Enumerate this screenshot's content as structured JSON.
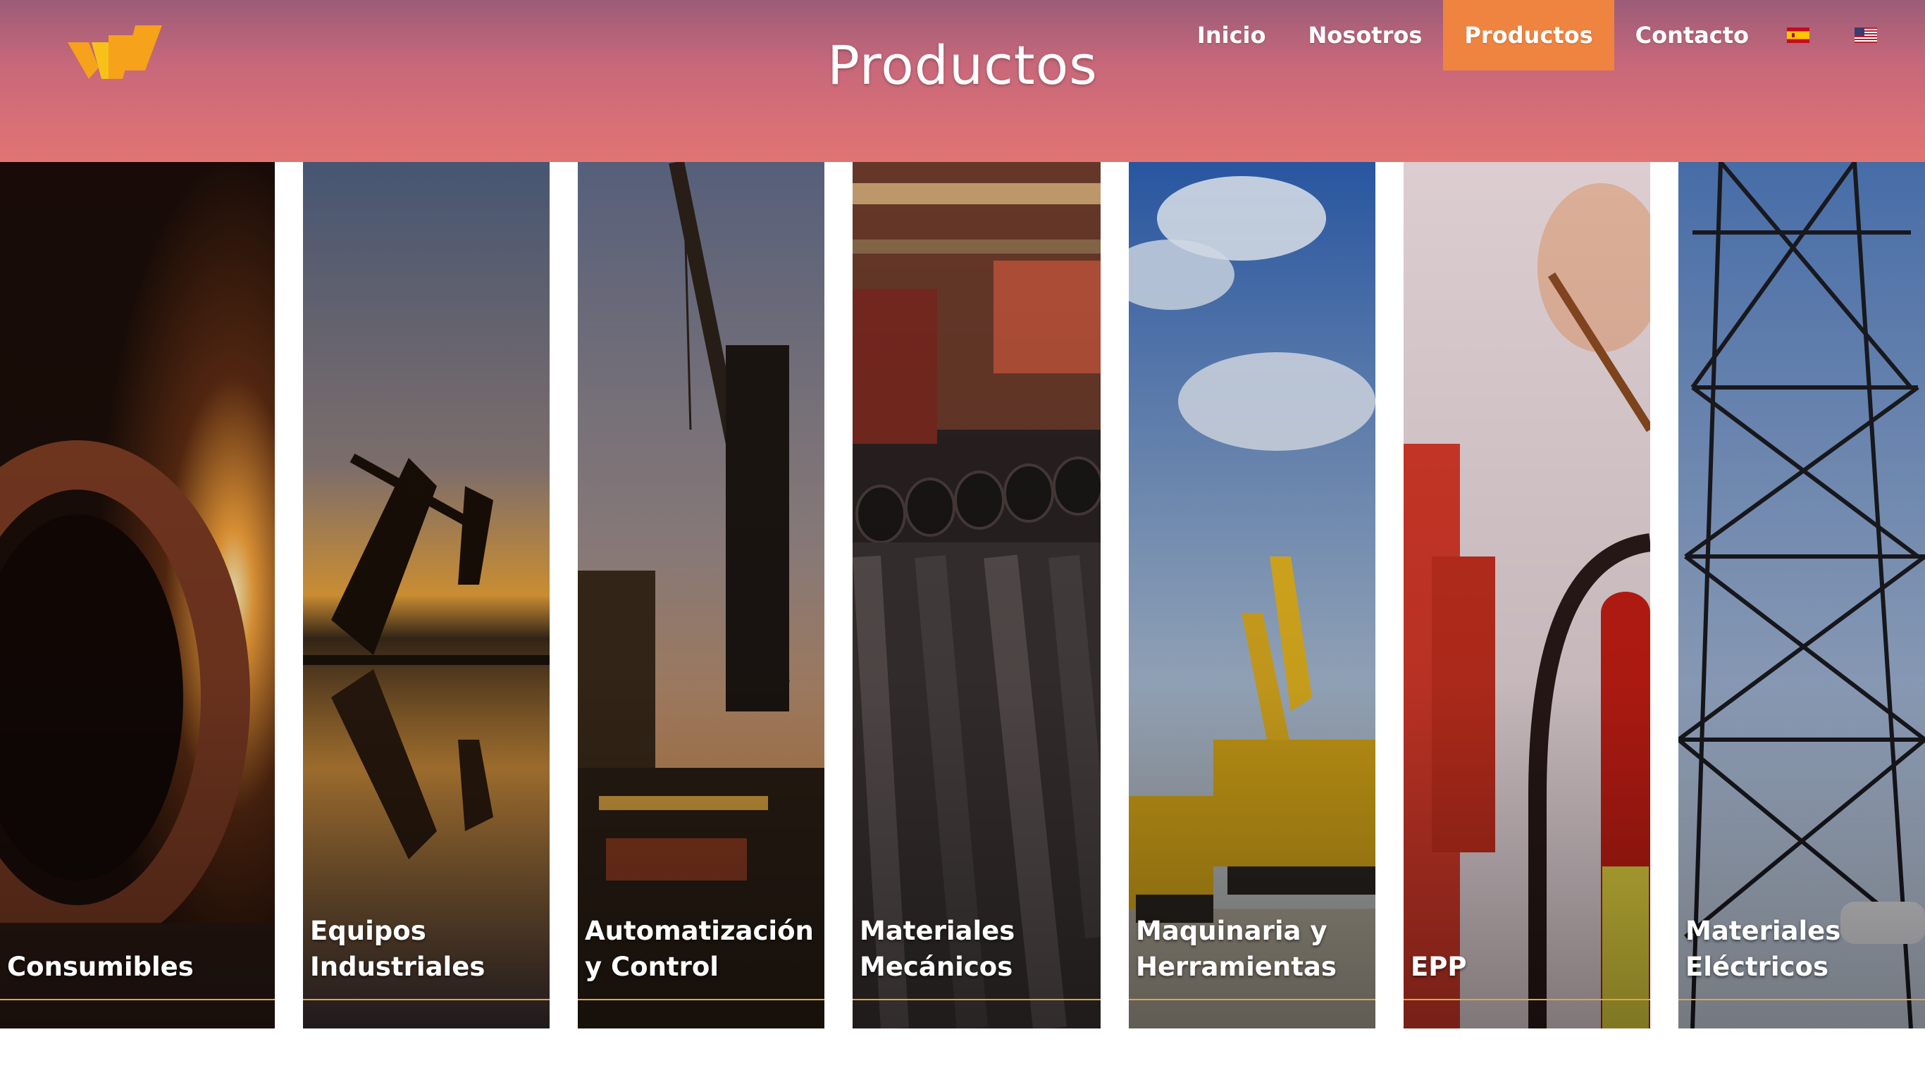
{
  "header": {
    "title": "Productos",
    "logo_name": "brand-logo",
    "colors": {
      "gradient_top": "#9c5c78",
      "gradient_bottom": "#e17473",
      "active_tab": "#ef8440",
      "logo": "#f6a21a"
    }
  },
  "nav": {
    "items": [
      {
        "label": "Inicio",
        "active": false
      },
      {
        "label": "Nosotros",
        "active": false
      },
      {
        "label": "Productos",
        "active": true
      },
      {
        "label": "Contacto",
        "active": false
      }
    ],
    "languages": [
      {
        "icon": "spain-flag-icon"
      },
      {
        "icon": "usa-flag-icon"
      }
    ]
  },
  "categories": [
    {
      "label": "Consumibles",
      "image": "welding-pipe-sparks"
    },
    {
      "label": "Equipos Industriales",
      "image": "oil-pumpjack-sunset"
    },
    {
      "label": "Automatización y Control",
      "image": "offshore-rig-crane"
    },
    {
      "label": "Materiales Mecánicos",
      "image": "steel-pipes-warehouse"
    },
    {
      "label": "Maquinaria y Herramientas",
      "image": "yellow-excavators"
    },
    {
      "label": "EPP",
      "image": "fire-extinguisher"
    },
    {
      "label": "Materiales Eléctricos",
      "image": "power-transmission-tower"
    }
  ]
}
